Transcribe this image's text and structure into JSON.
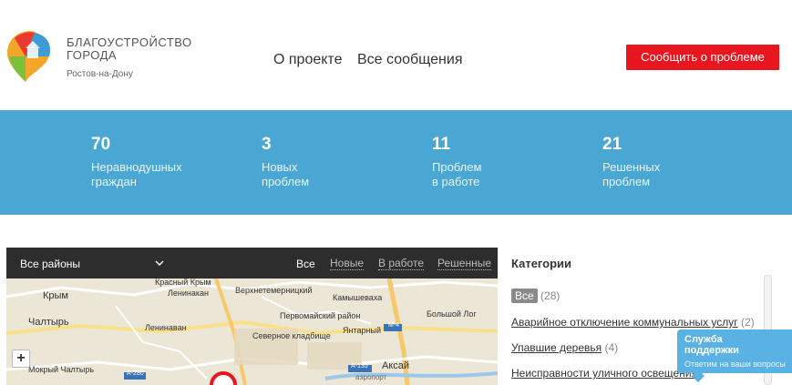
{
  "header": {
    "logo_line1": "БЛАГОУСТРОЙСТВО",
    "logo_line2": "ГОРОДА",
    "city": "Ростов-на-Дону",
    "nav": [
      "О проекте",
      "Все сообщения"
    ],
    "report_button": "Сообщить о проблеме"
  },
  "stats": [
    {
      "value": "70",
      "label": "Неравнодушных\nграждан"
    },
    {
      "value": "3",
      "label": "Новых\nпроблем"
    },
    {
      "value": "11",
      "label": "Проблем\nв работе"
    },
    {
      "value": "21",
      "label": "Решенных\nпроблем"
    }
  ],
  "map": {
    "district_select": "Все районы",
    "filters": [
      "Все",
      "Новые",
      "В работе",
      "Решенные"
    ],
    "active_filter": "Все",
    "zoom_in": "+",
    "marker_count": "6",
    "labels": [
      "Красный Крым",
      "Крым",
      "Ленинакан",
      "Верхнетемерницкий",
      "Камышеваха",
      "Чалтырь",
      "Ленинаван",
      "Первомайский район",
      "Северное кладбище",
      "Янтарный",
      "Большой Лог",
      "Мокрый Чалтырь",
      "Аксай",
      "M-4",
      "A-135",
      "A-280",
      "аэропорт"
    ]
  },
  "categories": {
    "title": "Категории",
    "all_label": "Все",
    "all_count": "(28)",
    "items": [
      {
        "label": "Аварийное отключение коммунальных услуг",
        "count": "(2)"
      },
      {
        "label": "Упавшие деревья",
        "count": "(4)"
      },
      {
        "label": "Неисправности уличного освещения",
        "count": ""
      }
    ]
  },
  "support": {
    "title": "Служба\nподдержки",
    "subtitle": "Ответим на ваши вопросы"
  },
  "colors": {
    "accent_red": "#e8161f",
    "stats_blue": "#4aa7d4",
    "support_blue": "#5ab1e4",
    "toolbar_dark": "#2d2d2d"
  }
}
